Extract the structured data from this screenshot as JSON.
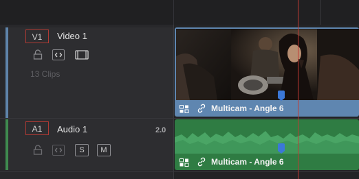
{
  "video_track": {
    "id": "V1",
    "name": "Video 1",
    "clip_count": "13 Clips",
    "clip": {
      "label": "Multicam - Angle 6"
    }
  },
  "audio_track": {
    "id": "A1",
    "name": "Audio 1",
    "channels": "2.0",
    "solo_label": "S",
    "mute_label": "M",
    "clip": {
      "label": "Multicam - Angle 6"
    }
  },
  "icons": {
    "lock": "lock-icon",
    "auto_select": "auto-select-icon",
    "monitor": "monitor-icon",
    "multicam_badge": "multicam-icon",
    "link": "link-icon"
  },
  "colors": {
    "video_track": "#5f84aa",
    "audio_track": "#3f8a4f",
    "video_clip": "#5f86b0",
    "audio_clip": "#2f7c43",
    "playhead": "#c23a34",
    "marker": "#3b78d8"
  }
}
